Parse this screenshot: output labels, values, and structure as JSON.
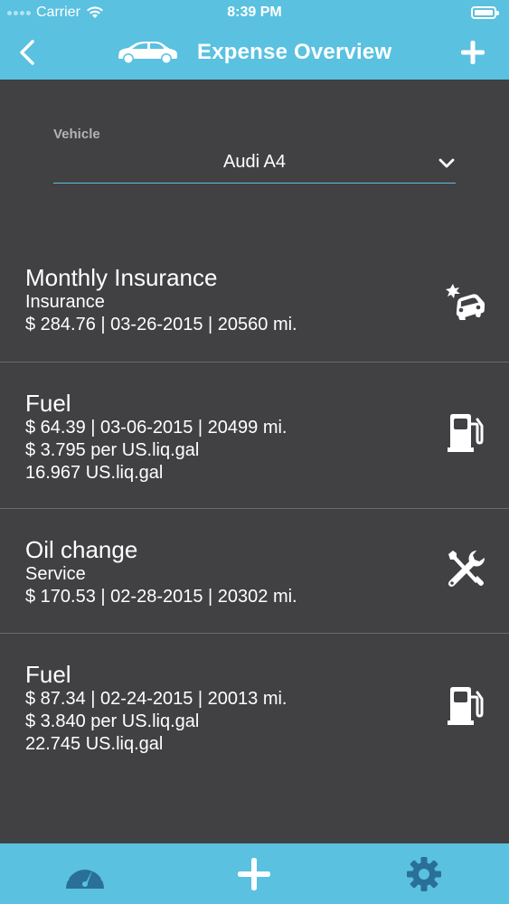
{
  "status_bar": {
    "carrier": "Carrier",
    "time": "8:39 PM"
  },
  "nav": {
    "title": "Expense Overview",
    "back_icon": "chevron-left-icon",
    "car_icon": "car-icon",
    "add_icon": "plus-icon"
  },
  "vehicle": {
    "label": "Vehicle",
    "value": "Audi A4"
  },
  "expenses": [
    {
      "title": "Monthly Insurance",
      "lines": [
        "Insurance",
        "$ 284.76 | 03-26-2015 | 20560 mi."
      ],
      "icon": "car-crash-icon"
    },
    {
      "title": "Fuel",
      "lines": [
        "$ 64.39 | 03-06-2015 | 20499 mi.",
        "$ 3.795 per US.liq.gal",
        "16.967 US.liq.gal"
      ],
      "icon": "fuel-pump-icon"
    },
    {
      "title": "Oil change",
      "lines": [
        "Service",
        "$ 170.53 | 02-28-2015 | 20302 mi."
      ],
      "icon": "tools-icon"
    },
    {
      "title": "Fuel",
      "lines": [
        "$ 87.34 | 02-24-2015 | 20013 mi.",
        "$ 3.840 per US.liq.gal",
        "22.745 US.liq.gal"
      ],
      "icon": "fuel-pump-icon"
    }
  ],
  "tabs": [
    {
      "icon": "speedometer-icon"
    },
    {
      "icon": "plus-icon"
    },
    {
      "icon": "gear-icon"
    }
  ],
  "colors": {
    "accent": "#5ac1e0",
    "background": "#414042",
    "dark_icon": "#2a6f97"
  }
}
